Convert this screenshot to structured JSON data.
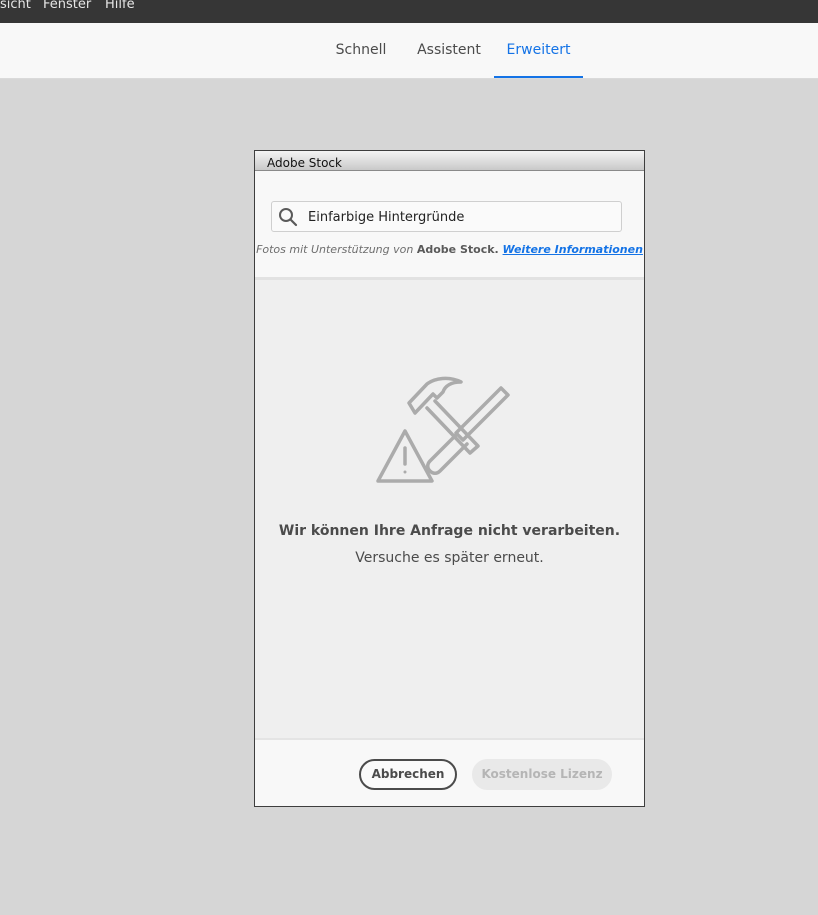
{
  "menubar": {
    "items": [
      "sicht",
      "Fenster",
      "Hilfe"
    ]
  },
  "modes": {
    "tabs": [
      {
        "label": "Schnell",
        "active": false
      },
      {
        "label": "Assistent",
        "active": false
      },
      {
        "label": "Erweitert",
        "active": true
      }
    ]
  },
  "dialog": {
    "title": "Adobe Stock",
    "search": {
      "value": "Einfarbige Hintergründe",
      "icon": "search-icon"
    },
    "credit": {
      "prefix": "Fotos mit Unterstützung von ",
      "brand": "Adobe Stock",
      "separator": ". ",
      "link": "Weitere Informationen"
    },
    "error": {
      "icon": "tools-warning-icon",
      "title": "Wir können Ihre Anfrage nicht verarbeiten.",
      "subtitle": "Versuche es später erneut."
    },
    "buttons": {
      "cancel": "Abbrechen",
      "license": "Kostenlose Lizenz"
    }
  },
  "colors": {
    "accent": "#1473e6",
    "menubar": "#363636",
    "workspace": "#d6d6d6"
  }
}
